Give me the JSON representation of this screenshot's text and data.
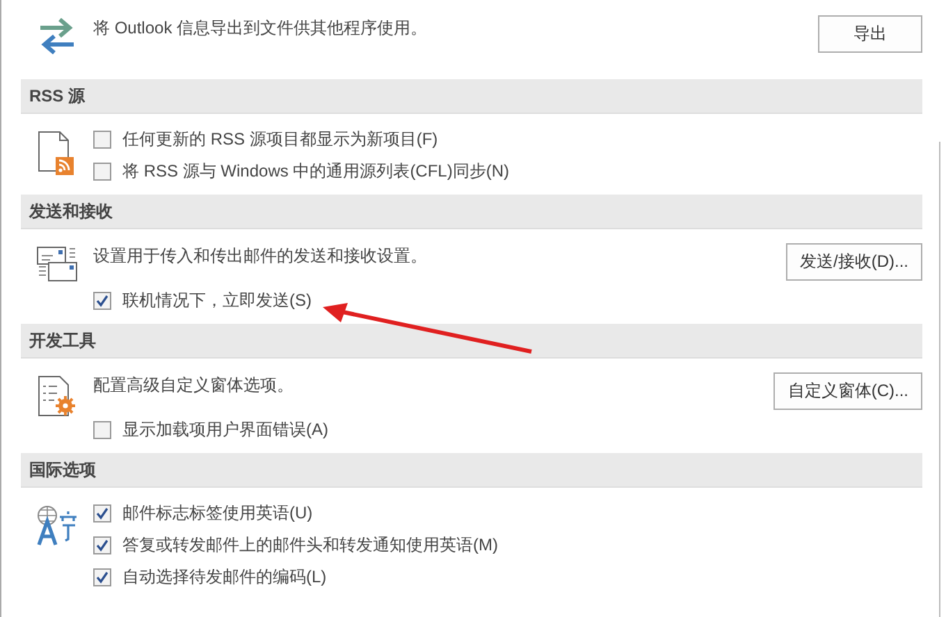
{
  "sections": [
    {
      "kind": "export",
      "description": "将 Outlook 信息导出到文件供其他程序使用。",
      "button": "导出"
    },
    {
      "header": "RSS 源",
      "kind": "rss",
      "options": [
        {
          "label": "任何更新的 RSS 源项目都显示为新项目(F)",
          "checked": false
        },
        {
          "label": "将 RSS 源与 Windows 中的通用源列表(CFL)同步(N)",
          "checked": false
        }
      ]
    },
    {
      "header": "发送和接收",
      "kind": "send-receive",
      "description": "设置用于传入和传出邮件的发送和接收设置。",
      "button": "发送/接收(D)...",
      "options": [
        {
          "label": "联机情况下，立即发送(S)",
          "checked": true
        }
      ]
    },
    {
      "header": "开发工具",
      "kind": "developer",
      "description": "配置高级自定义窗体选项。",
      "button": "自定义窗体(C)...",
      "options": [
        {
          "label": "显示加载项用户界面错误(A)",
          "checked": false
        }
      ]
    },
    {
      "header": "国际选项",
      "kind": "international",
      "options": [
        {
          "label": "邮件标志标签使用英语(U)",
          "checked": true
        },
        {
          "label": "答复或转发邮件上的邮件头和转发通知使用英语(M)",
          "checked": true
        },
        {
          "label": "自动选择待发邮件的编码(L)",
          "checked": true
        }
      ]
    }
  ]
}
